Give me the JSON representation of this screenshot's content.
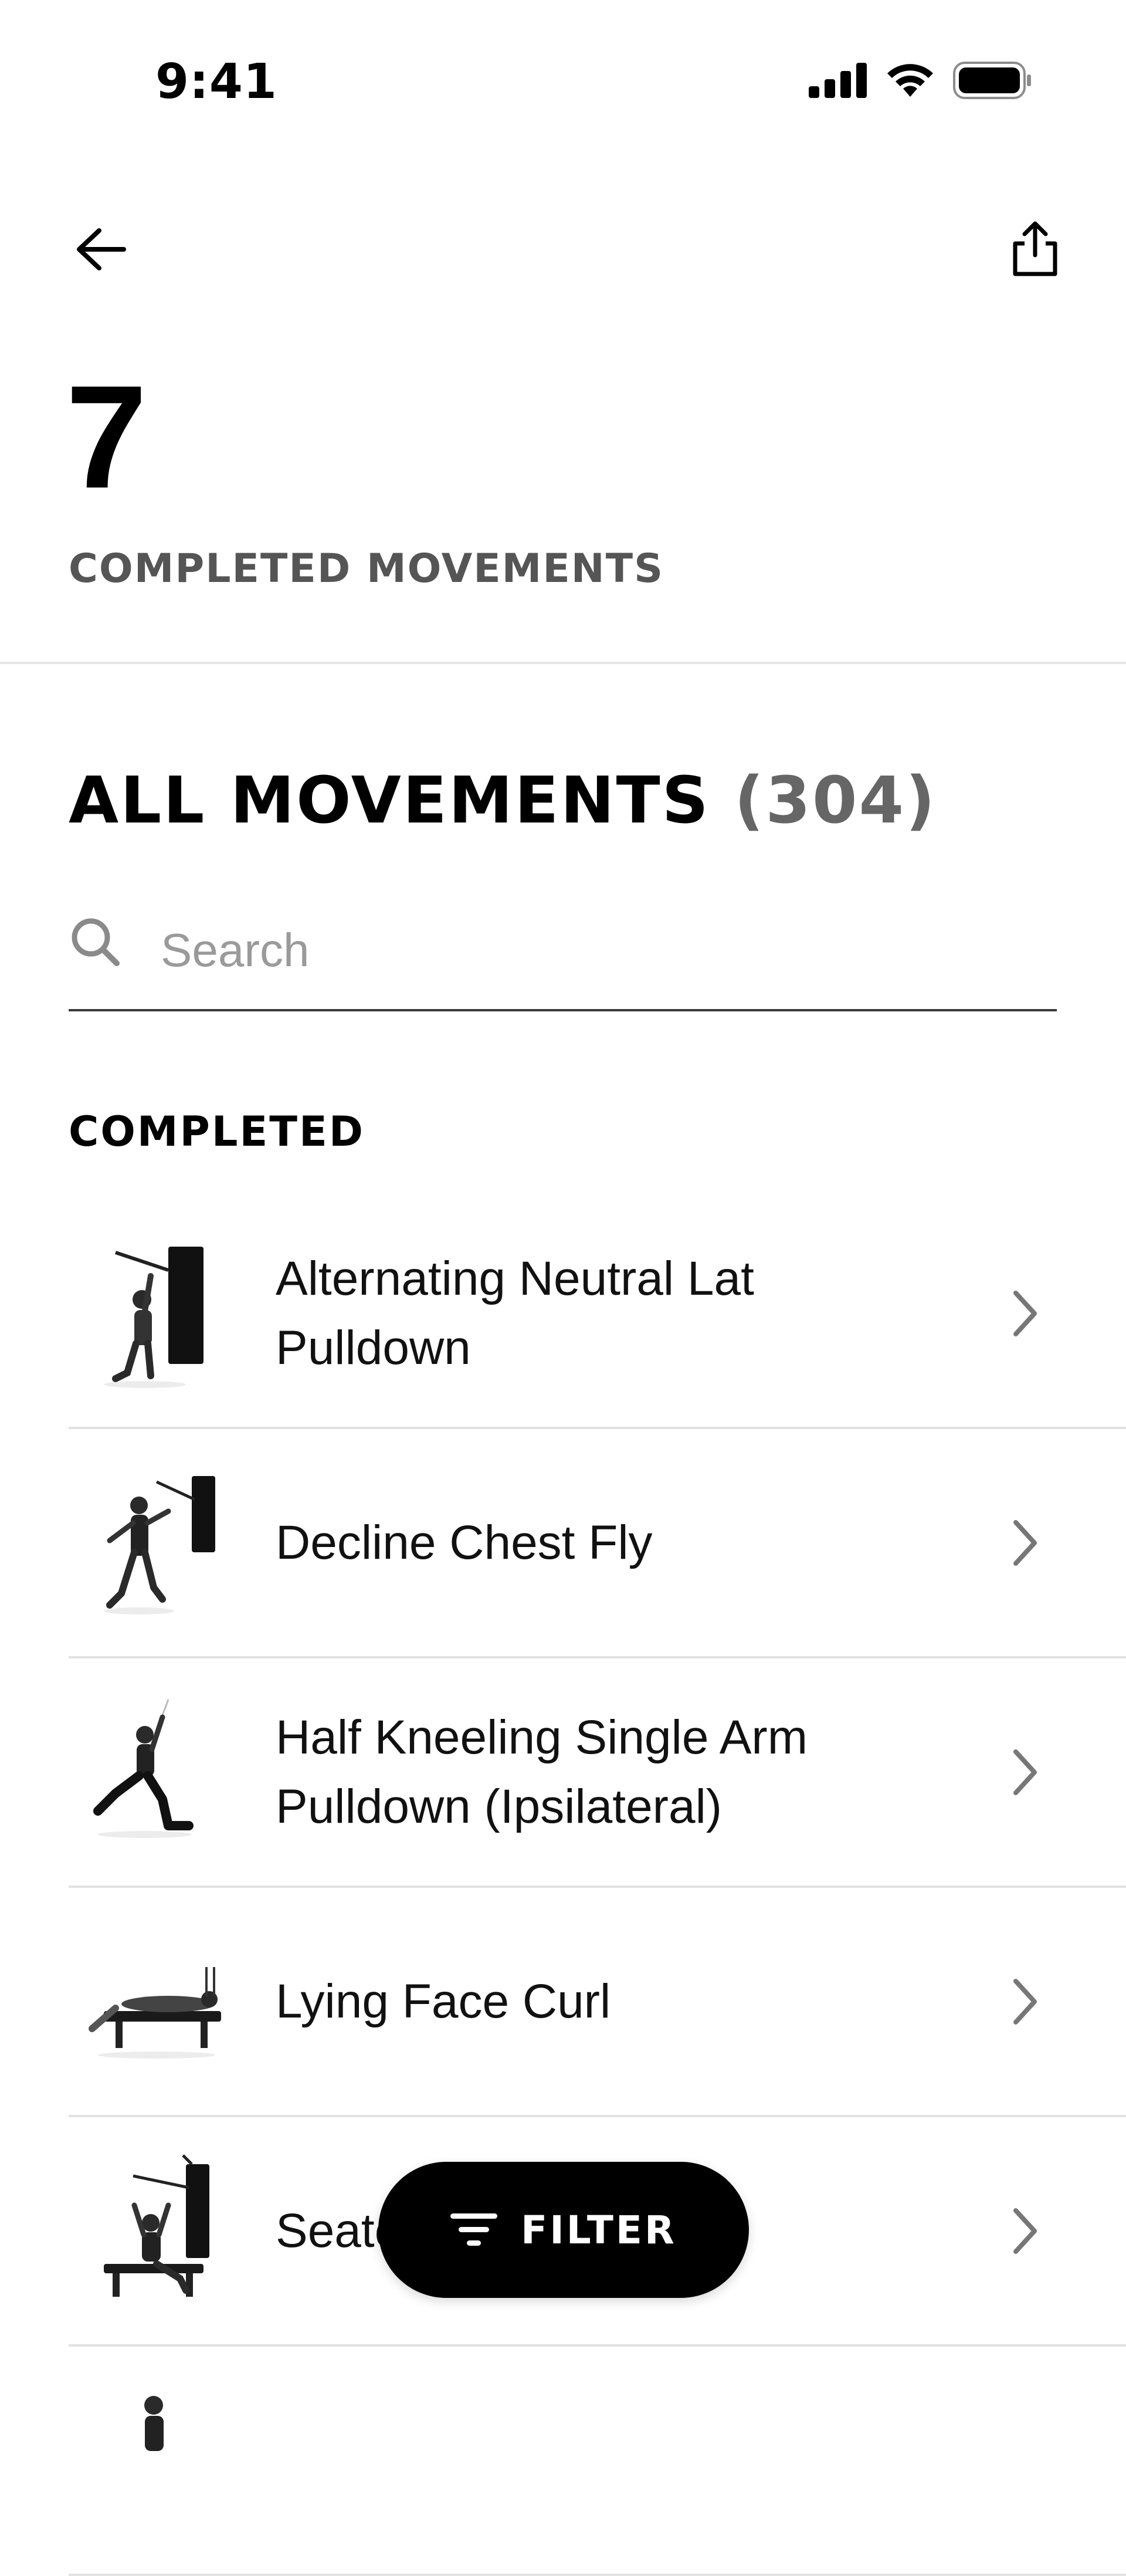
{
  "status_bar": {
    "time": "9:41"
  },
  "nav": {
    "back_icon": "arrow-left-icon",
    "share_icon": "share-icon"
  },
  "hero": {
    "count": "7",
    "label": "COMPLETED MOVEMENTS"
  },
  "all_movements": {
    "title": "ALL MOVEMENTS",
    "count": "(304)"
  },
  "search": {
    "placeholder": "Search",
    "value": ""
  },
  "completed": {
    "title": "COMPLETED",
    "items": [
      {
        "label": "Alternating Neutral Lat Pulldown"
      },
      {
        "label": "Decline Chest Fly"
      },
      {
        "label": "Half Kneeling Single Arm Pulldown (Ipsilateral)"
      },
      {
        "label": "Lying Face Curl"
      },
      {
        "label": "Seate"
      },
      {
        "label": ""
      }
    ]
  },
  "filter": {
    "label": "FILTER"
  }
}
